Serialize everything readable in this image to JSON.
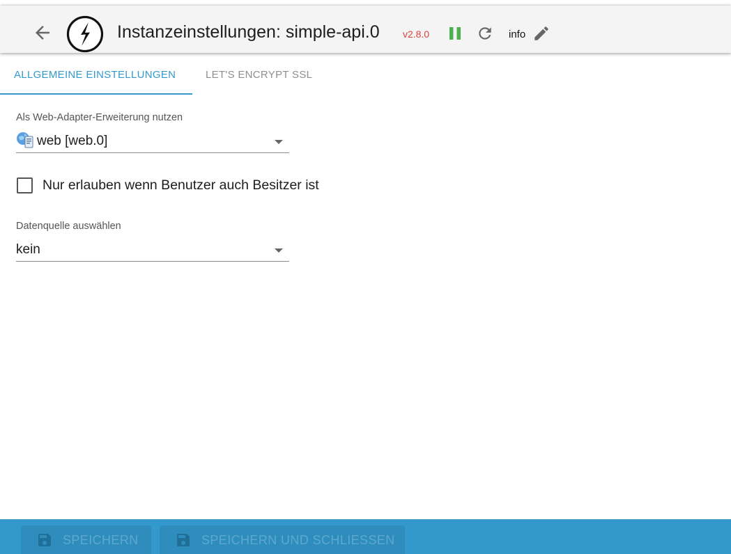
{
  "header": {
    "back_icon": "arrow-left-icon",
    "logo_icon": "lightning-bolt-circle-logo",
    "title": "Instanzeinstellungen: simple-api.0",
    "version": "v2.8.0",
    "pause_icon": "pause-icon",
    "reload_icon": "reload-icon",
    "info_label": "info",
    "edit_icon": "pencil-icon",
    "colors": {
      "version": "#e0403a",
      "pause": "#4caf50",
      "background": "#f4f4f4"
    }
  },
  "tabs": [
    {
      "label": "ALLGEMEINE EINSTELLUNGEN",
      "active": true
    },
    {
      "label": "LET'S ENCRYPT SSL",
      "active": false
    }
  ],
  "form": {
    "web_adapter": {
      "label": "Als Web-Adapter-Erweiterung nutzen",
      "value": "web [web.0]",
      "icon": "web-adapter-icon"
    },
    "owner_only": {
      "label": "Nur erlauben wenn Benutzer auch Besitzer ist",
      "checked": false
    },
    "data_source": {
      "label": "Datenquelle auswählen",
      "value": "kein"
    }
  },
  "footer": {
    "save_label": "SPEICHERN",
    "save_close_label": "SPEICHERN UND SCHLIESSEN",
    "save_icon": "floppy-disk-icon",
    "colors": {
      "bar": "#3399cc",
      "button": "#2e8dbd"
    }
  },
  "accent_color": "#3399cc"
}
